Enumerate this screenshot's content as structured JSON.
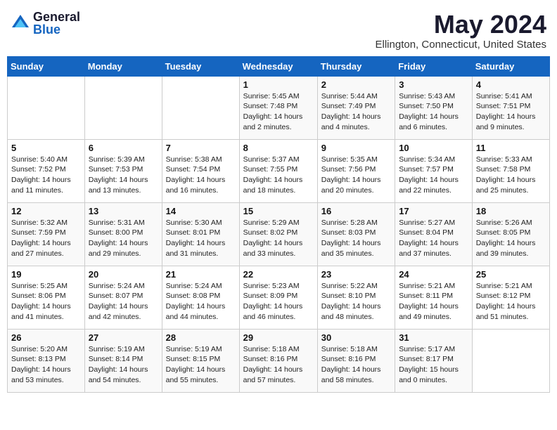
{
  "header": {
    "logo_general": "General",
    "logo_blue": "Blue",
    "month_title": "May 2024",
    "location": "Ellington, Connecticut, United States"
  },
  "days_of_week": [
    "Sunday",
    "Monday",
    "Tuesday",
    "Wednesday",
    "Thursday",
    "Friday",
    "Saturday"
  ],
  "weeks": [
    [
      {
        "num": "",
        "info": ""
      },
      {
        "num": "",
        "info": ""
      },
      {
        "num": "",
        "info": ""
      },
      {
        "num": "1",
        "info": "Sunrise: 5:45 AM\nSunset: 7:48 PM\nDaylight: 14 hours\nand 2 minutes."
      },
      {
        "num": "2",
        "info": "Sunrise: 5:44 AM\nSunset: 7:49 PM\nDaylight: 14 hours\nand 4 minutes."
      },
      {
        "num": "3",
        "info": "Sunrise: 5:43 AM\nSunset: 7:50 PM\nDaylight: 14 hours\nand 6 minutes."
      },
      {
        "num": "4",
        "info": "Sunrise: 5:41 AM\nSunset: 7:51 PM\nDaylight: 14 hours\nand 9 minutes."
      }
    ],
    [
      {
        "num": "5",
        "info": "Sunrise: 5:40 AM\nSunset: 7:52 PM\nDaylight: 14 hours\nand 11 minutes."
      },
      {
        "num": "6",
        "info": "Sunrise: 5:39 AM\nSunset: 7:53 PM\nDaylight: 14 hours\nand 13 minutes."
      },
      {
        "num": "7",
        "info": "Sunrise: 5:38 AM\nSunset: 7:54 PM\nDaylight: 14 hours\nand 16 minutes."
      },
      {
        "num": "8",
        "info": "Sunrise: 5:37 AM\nSunset: 7:55 PM\nDaylight: 14 hours\nand 18 minutes."
      },
      {
        "num": "9",
        "info": "Sunrise: 5:35 AM\nSunset: 7:56 PM\nDaylight: 14 hours\nand 20 minutes."
      },
      {
        "num": "10",
        "info": "Sunrise: 5:34 AM\nSunset: 7:57 PM\nDaylight: 14 hours\nand 22 minutes."
      },
      {
        "num": "11",
        "info": "Sunrise: 5:33 AM\nSunset: 7:58 PM\nDaylight: 14 hours\nand 25 minutes."
      }
    ],
    [
      {
        "num": "12",
        "info": "Sunrise: 5:32 AM\nSunset: 7:59 PM\nDaylight: 14 hours\nand 27 minutes."
      },
      {
        "num": "13",
        "info": "Sunrise: 5:31 AM\nSunset: 8:00 PM\nDaylight: 14 hours\nand 29 minutes."
      },
      {
        "num": "14",
        "info": "Sunrise: 5:30 AM\nSunset: 8:01 PM\nDaylight: 14 hours\nand 31 minutes."
      },
      {
        "num": "15",
        "info": "Sunrise: 5:29 AM\nSunset: 8:02 PM\nDaylight: 14 hours\nand 33 minutes."
      },
      {
        "num": "16",
        "info": "Sunrise: 5:28 AM\nSunset: 8:03 PM\nDaylight: 14 hours\nand 35 minutes."
      },
      {
        "num": "17",
        "info": "Sunrise: 5:27 AM\nSunset: 8:04 PM\nDaylight: 14 hours\nand 37 minutes."
      },
      {
        "num": "18",
        "info": "Sunrise: 5:26 AM\nSunset: 8:05 PM\nDaylight: 14 hours\nand 39 minutes."
      }
    ],
    [
      {
        "num": "19",
        "info": "Sunrise: 5:25 AM\nSunset: 8:06 PM\nDaylight: 14 hours\nand 41 minutes."
      },
      {
        "num": "20",
        "info": "Sunrise: 5:24 AM\nSunset: 8:07 PM\nDaylight: 14 hours\nand 42 minutes."
      },
      {
        "num": "21",
        "info": "Sunrise: 5:24 AM\nSunset: 8:08 PM\nDaylight: 14 hours\nand 44 minutes."
      },
      {
        "num": "22",
        "info": "Sunrise: 5:23 AM\nSunset: 8:09 PM\nDaylight: 14 hours\nand 46 minutes."
      },
      {
        "num": "23",
        "info": "Sunrise: 5:22 AM\nSunset: 8:10 PM\nDaylight: 14 hours\nand 48 minutes."
      },
      {
        "num": "24",
        "info": "Sunrise: 5:21 AM\nSunset: 8:11 PM\nDaylight: 14 hours\nand 49 minutes."
      },
      {
        "num": "25",
        "info": "Sunrise: 5:21 AM\nSunset: 8:12 PM\nDaylight: 14 hours\nand 51 minutes."
      }
    ],
    [
      {
        "num": "26",
        "info": "Sunrise: 5:20 AM\nSunset: 8:13 PM\nDaylight: 14 hours\nand 53 minutes."
      },
      {
        "num": "27",
        "info": "Sunrise: 5:19 AM\nSunset: 8:14 PM\nDaylight: 14 hours\nand 54 minutes."
      },
      {
        "num": "28",
        "info": "Sunrise: 5:19 AM\nSunset: 8:15 PM\nDaylight: 14 hours\nand 55 minutes."
      },
      {
        "num": "29",
        "info": "Sunrise: 5:18 AM\nSunset: 8:16 PM\nDaylight: 14 hours\nand 57 minutes."
      },
      {
        "num": "30",
        "info": "Sunrise: 5:18 AM\nSunset: 8:16 PM\nDaylight: 14 hours\nand 58 minutes."
      },
      {
        "num": "31",
        "info": "Sunrise: 5:17 AM\nSunset: 8:17 PM\nDaylight: 15 hours\nand 0 minutes."
      },
      {
        "num": "",
        "info": ""
      }
    ]
  ]
}
